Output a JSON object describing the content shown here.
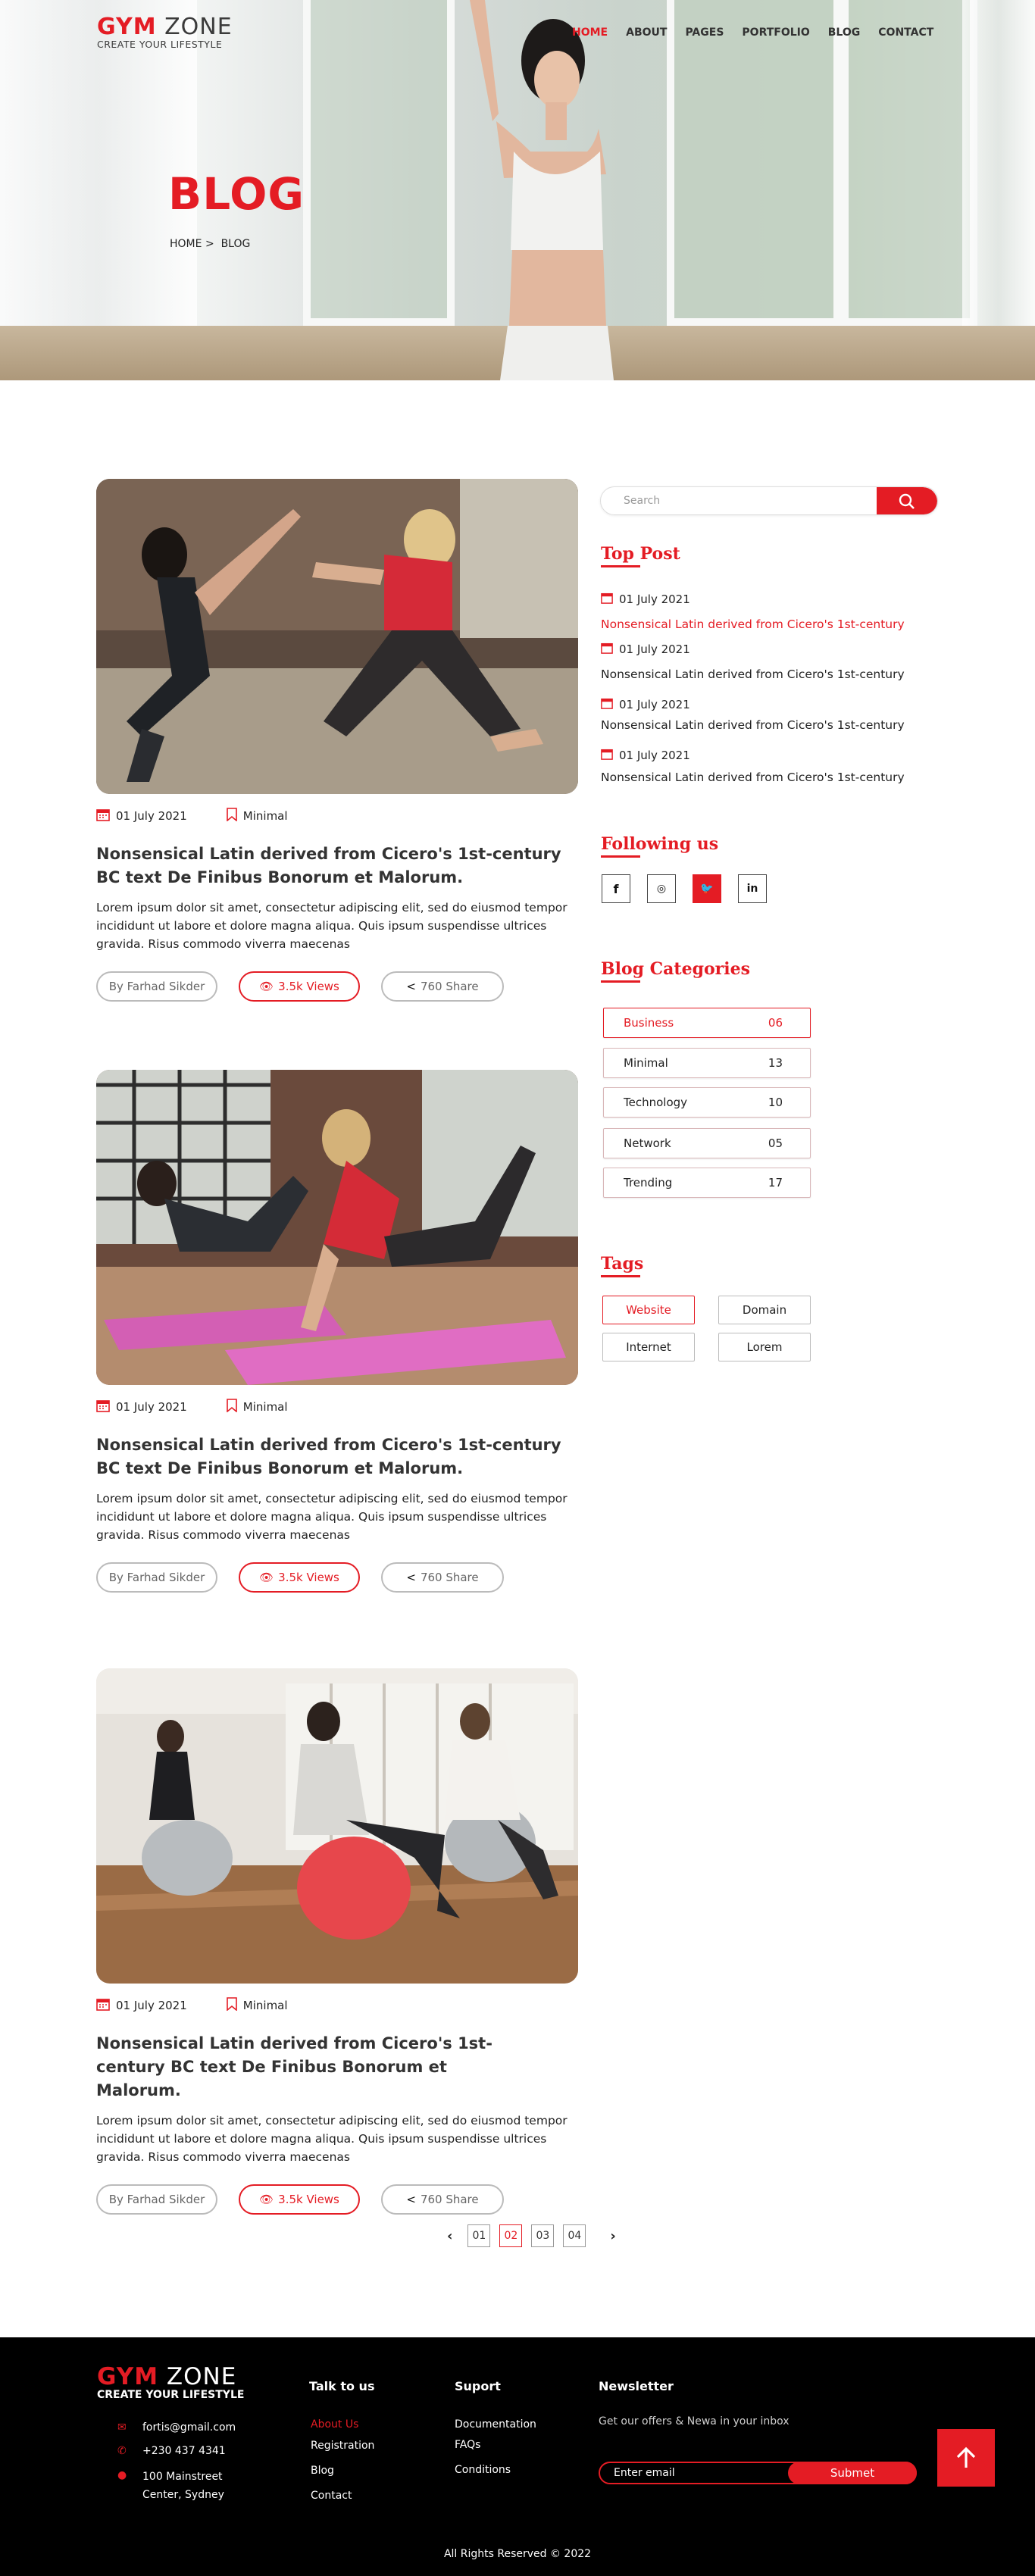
{
  "brand": {
    "logo_red": "GYM",
    "logo_dark": "ZONE",
    "tagline": "CREATE YOUR LIFESTYLE"
  },
  "nav": [
    {
      "label": "HOME",
      "active": true
    },
    {
      "label": "ABOUT"
    },
    {
      "label": "PAGES"
    },
    {
      "label": "PORTFOLIO"
    },
    {
      "label": "BLOG"
    },
    {
      "label": "CONTACT"
    }
  ],
  "hero": {
    "title": "BLOG",
    "crumb_home": "HOME",
    "crumb_sep": ">",
    "crumb_current": "BLOG"
  },
  "posts": [
    {
      "date": "01 July 2021",
      "category": "Minimal",
      "title": "Nonsensical Latin derived from Cicero's 1st-century BC text De Finibus Bonorum et Malorum.",
      "body": "Lorem ipsum dolor sit amet, consectetur adipiscing elit, sed do eiusmod tempor incididunt ut labore et dolore magna aliqua. Quis ipsum suspendisse ultrices gravida. Risus commodo viverra maecenas",
      "author": "By Farhad Sikder",
      "views": "3.5k Views",
      "share": "760 Share"
    },
    {
      "date": "01 July 2021",
      "category": "Minimal",
      "title": "Nonsensical Latin derived from Cicero's 1st-century BC text De Finibus Bonorum et Malorum.",
      "body": "Lorem ipsum dolor sit amet, consectetur adipiscing elit, sed do eiusmod tempor incididunt ut labore et dolore magna aliqua. Quis ipsum suspendisse ultrices gravida. Risus commodo viverra maecenas",
      "author": "By Farhad Sikder",
      "views": "3.5k Views",
      "share": "760 Share"
    },
    {
      "date": "01 July 2021",
      "category": "Minimal",
      "title": "Nonsensical Latin derived from Cicero's 1st-century BC text De Finibus Bonorum et Malorum.",
      "body": "Lorem ipsum dolor sit amet, consectetur adipiscing elit, sed do eiusmod tempor incididunt ut labore et dolore magna aliqua. Quis ipsum suspendisse ultrices gravida. Risus commodo viverra maecenas",
      "author": "By Farhad Sikder",
      "views": "3.5k Views",
      "share": "760 Share"
    }
  ],
  "sidebar": {
    "search_placeholder": "Search",
    "top_post_title": "Top Post",
    "top_posts": [
      {
        "date": "01 July 2021",
        "text": "Nonsensical Latin derived  from Cicero's 1st-century"
      },
      {
        "date": "01 July 2021",
        "text": "Nonsensical Latin derived  from Cicero's 1st-century"
      },
      {
        "date": "01 July 2021",
        "text": "Nonsensical Latin derived  from Cicero's 1st-century"
      },
      {
        "date": "01 July 2021",
        "text": "Nonsensical Latin derived  from Cicero's 1st-century"
      }
    ],
    "following_title": "Following us",
    "social": [
      {
        "icon": "facebook-icon",
        "glyph": "f"
      },
      {
        "icon": "instagram-icon",
        "glyph": "◎"
      },
      {
        "icon": "twitter-icon",
        "glyph": "🐦"
      },
      {
        "icon": "linkedin-icon",
        "glyph": "in"
      }
    ],
    "categories_title": "Blog Categories",
    "categories": [
      {
        "name": "Business",
        "count": "06"
      },
      {
        "name": "Minimal",
        "count": "13"
      },
      {
        "name": "Technology",
        "count": "10"
      },
      {
        "name": "Network",
        "count": "05"
      },
      {
        "name": "Trending",
        "count": "17"
      }
    ],
    "tags_title": "Tags",
    "tags": [
      "Website",
      "Domain",
      "Internet",
      "Lorem"
    ]
  },
  "pagination": {
    "pages": [
      "01",
      "02",
      "03",
      "04"
    ],
    "current": "02",
    "prev": "‹",
    "next": "›"
  },
  "footer": {
    "logo_red": "GYM",
    "logo_white": "ZONE",
    "tagline": "CREATE YOUR LIFESTYLE",
    "email": "fortis@gmail.com",
    "phone": "+230 437 4341",
    "address_1": "100 Mainstreet",
    "address_2": "Center, Sydney",
    "talk_title": "Talk to us",
    "talk_links": [
      "About Us",
      "Registration",
      "Blog",
      "Contact"
    ],
    "support_title": "Suport",
    "support_links": [
      "Documentation",
      "FAQs",
      "Conditions"
    ],
    "newsletter_title": "Newsletter",
    "newsletter_text": "Get our offers & Newa in your inbox",
    "newsletter_placeholder": "Enter email",
    "newsletter_button": "Submet",
    "copyright": "All Rights Reserved © 2022"
  },
  "colors": {
    "accent": "#e41c24",
    "footer_bg": "#000000"
  }
}
